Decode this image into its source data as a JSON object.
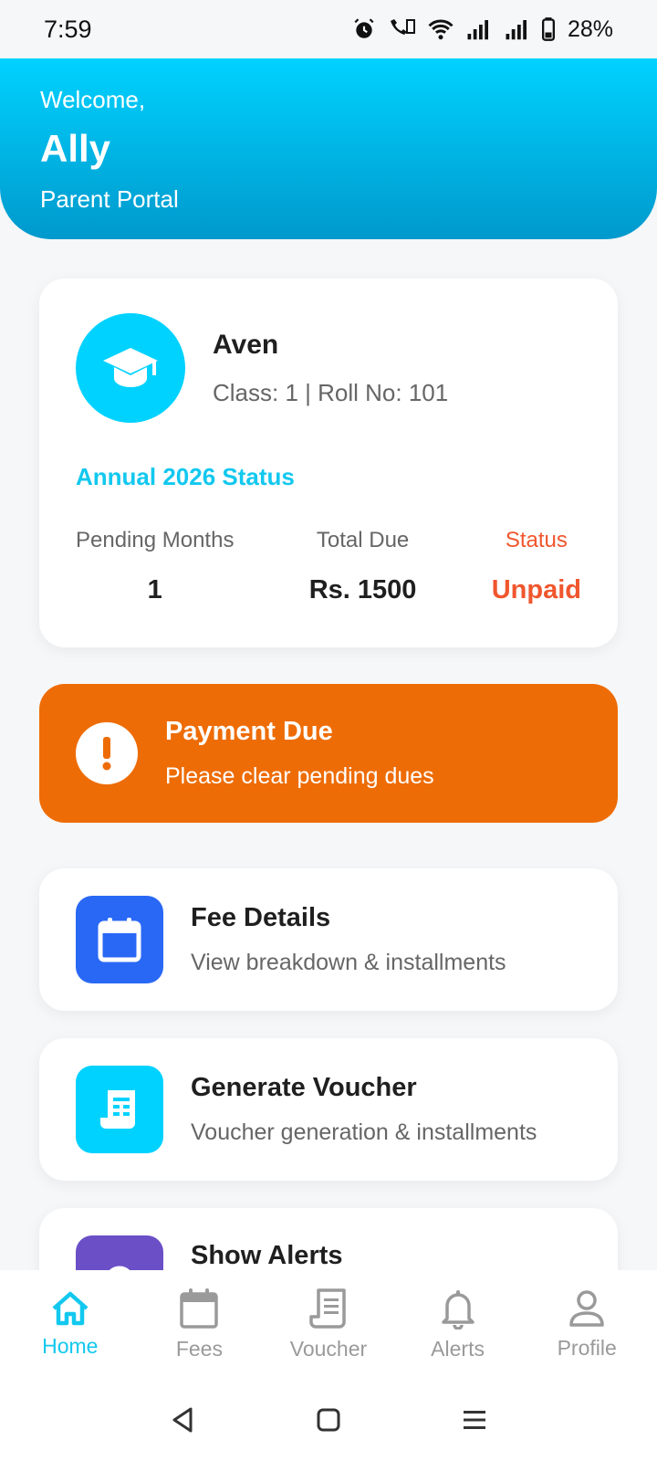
{
  "status_bar": {
    "time": "7:59",
    "battery": "28%",
    "icons": [
      "alarm-icon",
      "volte-call-icon",
      "wifi-icon",
      "signal-icon",
      "signal-icon",
      "battery-icon"
    ]
  },
  "header": {
    "welcome": "Welcome,",
    "name": "Ally",
    "subtitle": "Parent Portal"
  },
  "student": {
    "name": "Aven",
    "class_roll": "Class: 1 | Roll No: 101",
    "annual_title": "Annual 2026 Status",
    "stats": [
      {
        "label": "Pending Months",
        "value": "1"
      },
      {
        "label": "Total Due",
        "value": "Rs. 1500"
      },
      {
        "label": "Status",
        "value": "Unpaid"
      }
    ]
  },
  "alert_banner": {
    "title": "Payment Due",
    "subtitle": "Please clear pending dues"
  },
  "actions": [
    {
      "title": "Fee Details",
      "subtitle": "View breakdown & installments",
      "icon": "calendar-icon",
      "color": "#2968f5"
    },
    {
      "title": "Generate Voucher",
      "subtitle": "Voucher generation & installments",
      "icon": "receipt-icon",
      "color": "#00d2ff"
    },
    {
      "title": "Show Alerts",
      "subtitle": "",
      "icon": "bell-icon",
      "color": "#6a4fc6"
    }
  ],
  "bottom_nav": [
    {
      "label": "Home",
      "icon": "home-icon",
      "active": true
    },
    {
      "label": "Fees",
      "icon": "calendar-icon",
      "active": false
    },
    {
      "label": "Voucher",
      "icon": "receipt-icon",
      "active": false
    },
    {
      "label": "Alerts",
      "icon": "bell-icon",
      "active": false
    },
    {
      "label": "Profile",
      "icon": "person-icon",
      "active": false
    }
  ],
  "colors": {
    "accent": "#12c8ef",
    "header_top": "#00d2ff",
    "header_bottom": "#0099cc",
    "warning": "#ee6c05",
    "unpaid": "#f0562d"
  }
}
